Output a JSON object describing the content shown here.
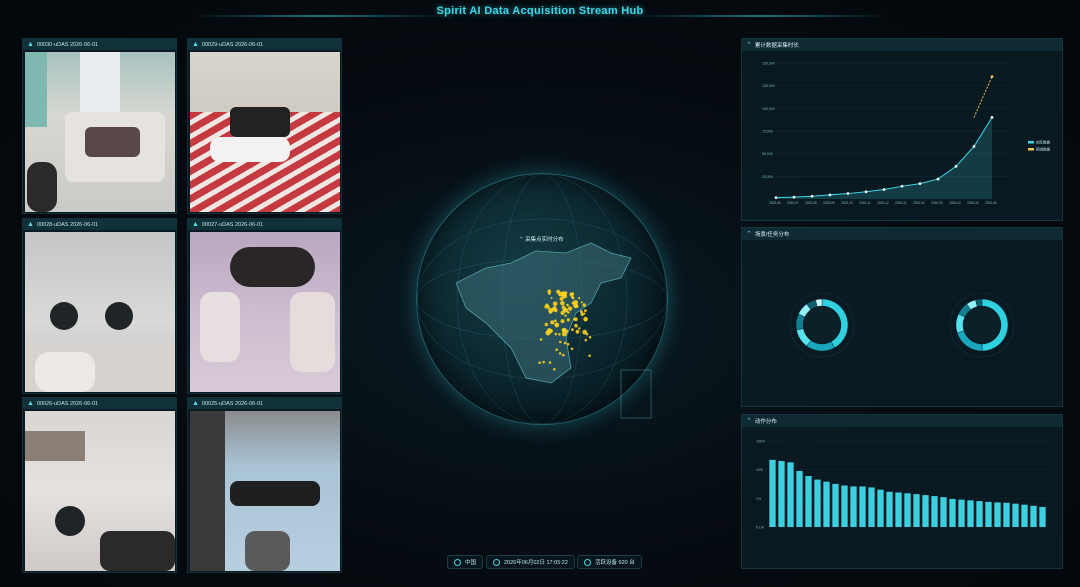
{
  "header": {
    "title": "Spirit AI Data Acquisition Stream Hub"
  },
  "cameras": [
    {
      "label": "00030-uDAS 2026-06-01"
    },
    {
      "label": "00029-uDAS 2026-06-01"
    },
    {
      "label": "00028-uDAS 2026-06-01"
    },
    {
      "label": "00027-uDAS 2026-06-01"
    },
    {
      "label": "00026-uDAS 2026-06-01"
    },
    {
      "label": "00025-uDAS 2026-06-01"
    }
  ],
  "globe": {
    "label": "采集点实时分布"
  },
  "status_bar": {
    "region": "中国",
    "datetime": "2026年06月02日 17:05:22",
    "devices": "活跃设备 920 台"
  },
  "panels": {
    "cumulative": {
      "title": "累计数据采集时长"
    },
    "scene_task": {
      "title": "场景/任务分布"
    },
    "action": {
      "title": "动作分布"
    }
  },
  "colors": {
    "accent": "#3fd6e6",
    "forecast": "#f2c25a",
    "point": "#ffd21a"
  },
  "chart_data": [
    {
      "type": "line",
      "title": "累计数据采集时长",
      "x": [
        "2025-06",
        "2025-07",
        "2025-08",
        "2025-09",
        "2025-10",
        "2025-11",
        "2025-12",
        "2026-01",
        "2026-02",
        "2026-03",
        "2026-04",
        "2026-05",
        "2026-06"
      ],
      "y_ticks": [
        "150,000",
        "125,000",
        "100,000",
        "75,000",
        "50,000",
        "25,000"
      ],
      "ylim": [
        0,
        150000
      ],
      "series": [
        {
          "name": "实际数据",
          "values": [
            1500,
            2000,
            3000,
            4500,
            6000,
            8000,
            10500,
            14000,
            17000,
            22000,
            36000,
            58000,
            90000
          ]
        },
        {
          "name": "预测数据",
          "values": [
            null,
            null,
            null,
            null,
            null,
            null,
            null,
            null,
            null,
            null,
            null,
            90000,
            135000
          ]
        }
      ],
      "legend": "right"
    },
    {
      "type": "pie",
      "title": "场景/任务分布",
      "series": [
        {
          "values": [
            42,
            18,
            12,
            10,
            8,
            6,
            4
          ]
        },
        {
          "values": [
            50,
            20,
            12,
            8,
            6,
            4
          ]
        }
      ]
    },
    {
      "type": "bar",
      "title": "动作分布",
      "y_ticks": [
        "100%",
        "10%",
        "1%",
        "0.1%"
      ],
      "ylim": [
        0.1,
        100
      ],
      "values": [
        22,
        20,
        18,
        9,
        6,
        4.5,
        3.8,
        3.2,
        2.8,
        2.6,
        2.6,
        2.4,
        2.0,
        1.7,
        1.6,
        1.5,
        1.4,
        1.3,
        1.2,
        1.1,
        0.95,
        0.9,
        0.85,
        0.8,
        0.75,
        0.72,
        0.7,
        0.65,
        0.6,
        0.55,
        0.5
      ]
    }
  ]
}
